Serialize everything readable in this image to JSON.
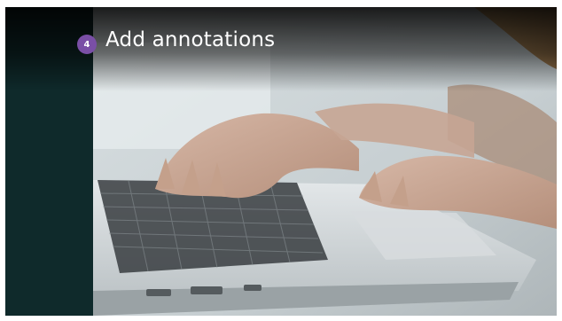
{
  "slide": {
    "step_number": "4",
    "title": "Add annotations"
  },
  "colors": {
    "left_band": "#0f2a2b",
    "badge": "#7a4fa6",
    "title_text": "#ffffff"
  },
  "photo": {
    "subject": "hands-typing-on-laptop-image"
  }
}
